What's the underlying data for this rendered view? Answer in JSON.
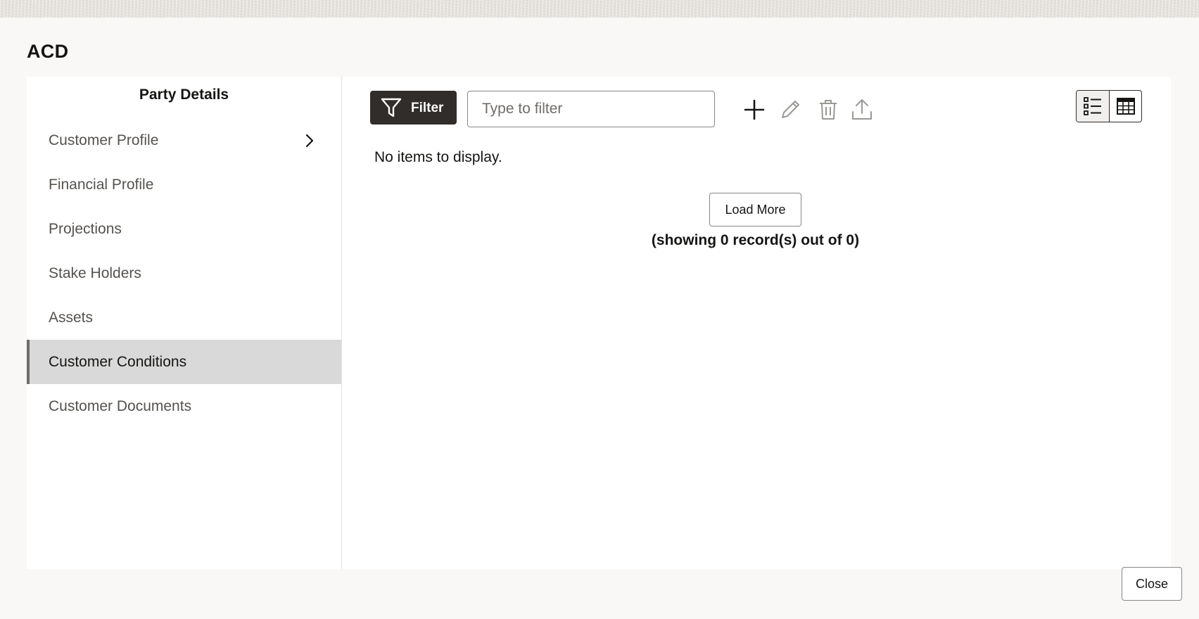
{
  "dialog": {
    "title": "ACD",
    "close_label": "Close"
  },
  "sidebar": {
    "heading": "Party Details",
    "items": [
      {
        "label": "Customer Profile",
        "has_chevron": true
      },
      {
        "label": "Financial Profile"
      },
      {
        "label": "Projections"
      },
      {
        "label": "Stake Holders"
      },
      {
        "label": "Assets"
      },
      {
        "label": "Customer Conditions",
        "active": true
      },
      {
        "label": "Customer Documents"
      }
    ]
  },
  "toolbar": {
    "filter_label": "Filter",
    "filter_placeholder": "Type to filter",
    "icons": [
      "filter-icon",
      "add-icon",
      "edit-icon",
      "delete-icon",
      "upload-icon",
      "list-view-icon",
      "table-view-icon"
    ]
  },
  "main": {
    "empty_message": "No items to display.",
    "load_more_label": "Load More",
    "records_summary": "(showing 0 record(s) out of 0)"
  },
  "colors": {
    "primary_button": "#312d2a",
    "active_nav_bg": "#d9d9d9",
    "active_nav_bar": "#6f6c69",
    "muted_icon": "#9a9895"
  }
}
